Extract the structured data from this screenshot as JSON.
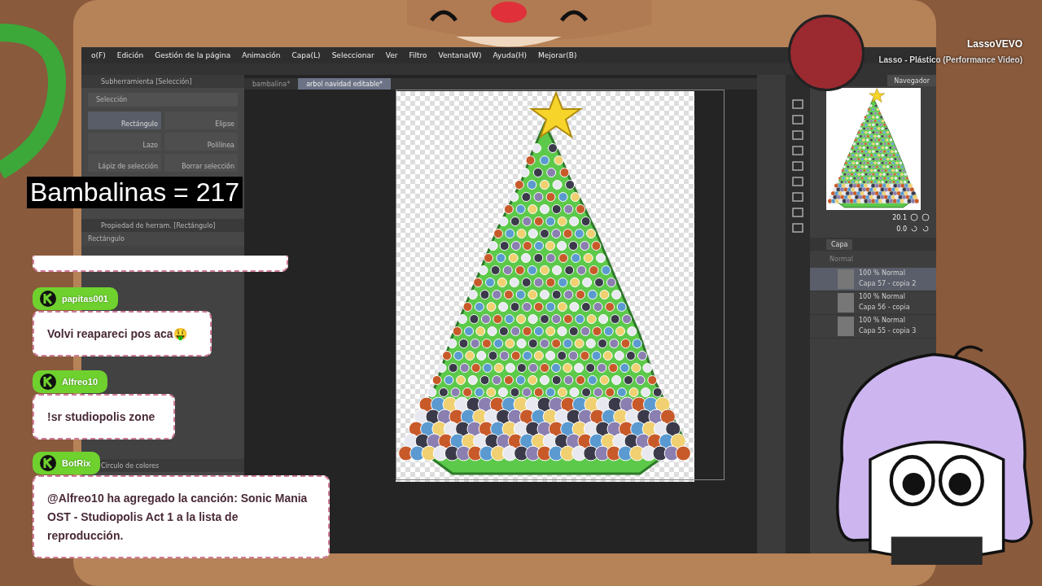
{
  "app": {
    "menu": [
      "o(F)",
      "Edición",
      "Gestión de la página",
      "Animación",
      "Capa(L)",
      "Seleccionar",
      "Ver",
      "Filtro",
      "Ventana(W)",
      "Ayuda(H)",
      "Mejorar(B)"
    ],
    "subtool_panel": {
      "title": "Subherramienta [Selección]",
      "group": "Selección",
      "tools": [
        {
          "label": "Rectángulo",
          "selected": true
        },
        {
          "label": "Elipse",
          "selected": false
        },
        {
          "label": "Lazo",
          "selected": false
        },
        {
          "label": "Polilínea",
          "selected": false
        },
        {
          "label": "Lápiz de selección",
          "selected": false
        },
        {
          "label": "Borrar selección",
          "selected": false
        }
      ]
    },
    "property_panel": {
      "title": "Propiedad de herram. [Rectángulo]",
      "subtitle": "Rectángulo"
    },
    "color_panel": {
      "title": "Círculo de colores"
    },
    "doc_tabs": [
      {
        "label": "bambalina*",
        "selected": false
      },
      {
        "label": "arbol navidad editable*",
        "selected": true
      }
    ],
    "navigator": {
      "tab": "Navegador",
      "zoom": "20.1",
      "angle": "0.0"
    },
    "layer_panel": {
      "tab": "Capa",
      "blend": "Normal",
      "layers": [
        {
          "mode": "100 % Normal",
          "name": "Capa 57 - copia 2",
          "selected": true
        },
        {
          "mode": "100 % Normal",
          "name": "Capa 56 - copia",
          "selected": false
        },
        {
          "mode": "100 % Normal",
          "name": "Capa 55 - copia 3",
          "selected": false
        }
      ]
    }
  },
  "counter": "Bambalinas = 217",
  "now_playing": {
    "artist": "LassoVEVO",
    "title": "Lasso - Plástico (Performance Video)"
  },
  "chat": [
    {
      "user": "papitas001",
      "text": "Volvi reapareci pos aca🤑"
    },
    {
      "user": "Alfreo10",
      "text": "!sr studiopolis zone"
    },
    {
      "user": "BotRix",
      "text": "@Alfreo10 ha agregado la canción: Sonic Mania OST - Studiopolis Act 1 a la lista de reproducción."
    }
  ]
}
